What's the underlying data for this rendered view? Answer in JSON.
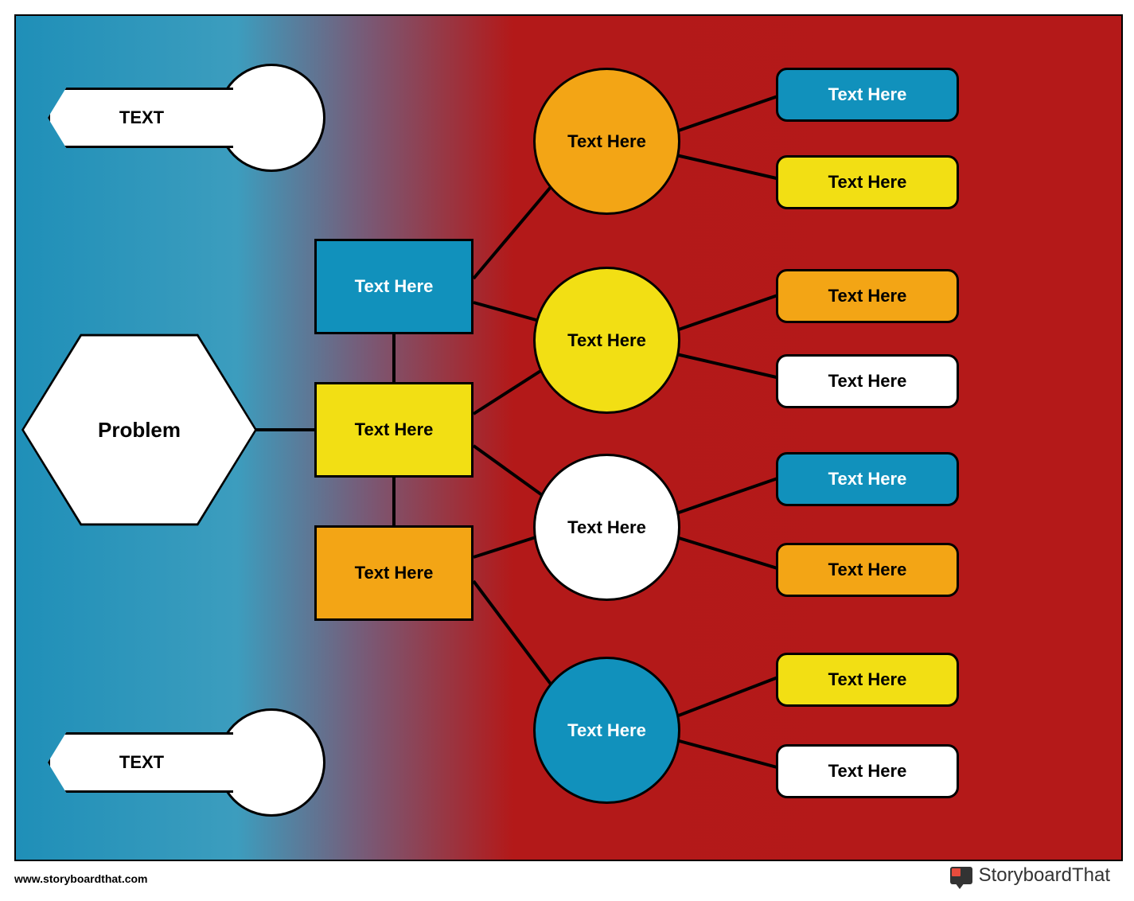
{
  "banners": {
    "top": "TEXT",
    "bottom": "TEXT"
  },
  "root": "Problem",
  "level1": {
    "a": "Text Here",
    "b": "Text Here",
    "c": "Text Here"
  },
  "level2": {
    "a": "Text Here",
    "b": "Text Here",
    "c": "Text Here",
    "d": "Text Here"
  },
  "level3": {
    "a1": "Text Here",
    "a2": "Text Here",
    "b1": "Text Here",
    "b2": "Text Here",
    "c1": "Text Here",
    "c2": "Text Here",
    "d1": "Text Here",
    "d2": "Text Here"
  },
  "colors": {
    "blue": "#1191bc",
    "yellow": "#f2df14",
    "orange": "#f3a515",
    "white": "#ffffff"
  },
  "footer": "www.storyboardthat.com",
  "brand": "StoryboardThat"
}
